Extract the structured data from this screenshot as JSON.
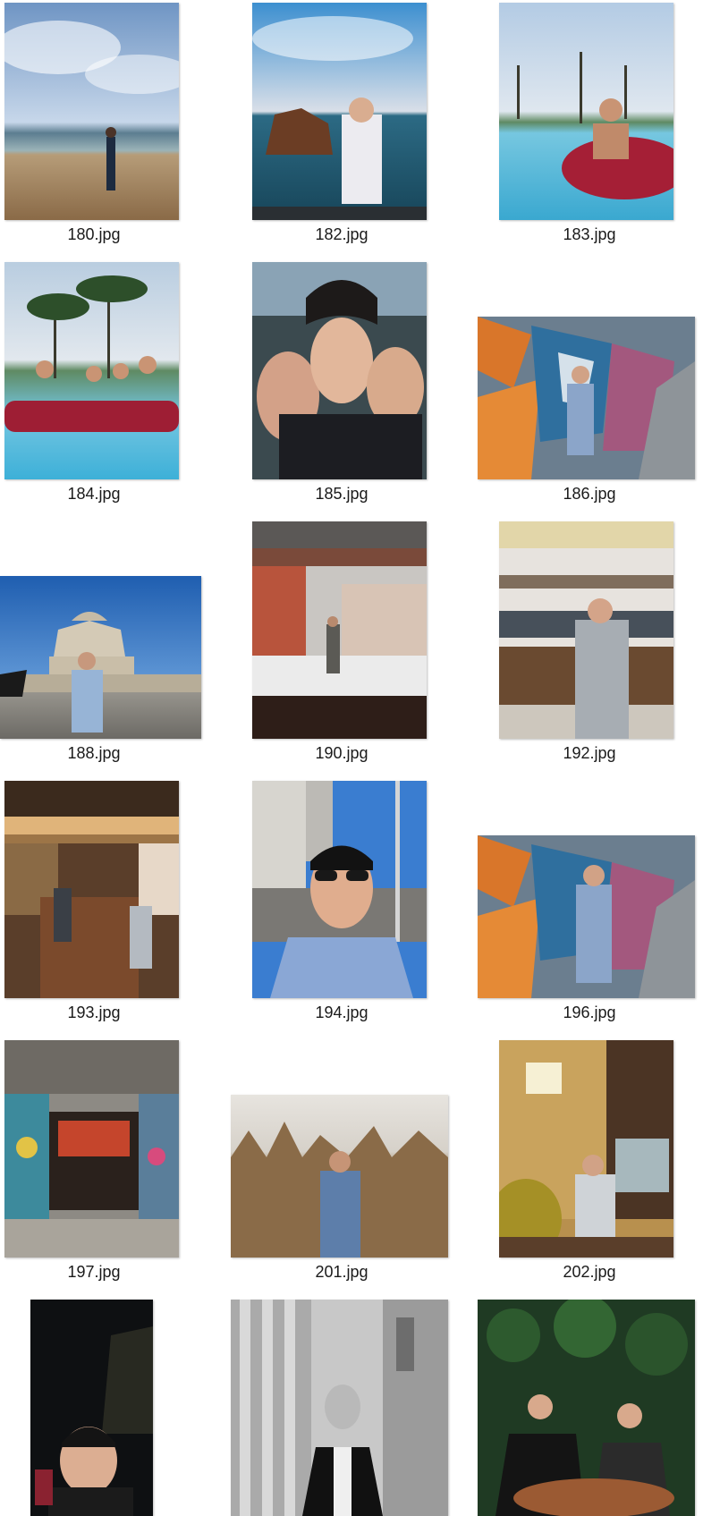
{
  "files": [
    {
      "name": "180.jpg"
    },
    {
      "name": "182.jpg"
    },
    {
      "name": "183.jpg"
    },
    {
      "name": "184.jpg"
    },
    {
      "name": "185.jpg"
    },
    {
      "name": "186.jpg"
    },
    {
      "name": "188.jpg"
    },
    {
      "name": "190.jpg"
    },
    {
      "name": "192.jpg"
    },
    {
      "name": "193.jpg"
    },
    {
      "name": "194.jpg"
    },
    {
      "name": "196.jpg"
    },
    {
      "name": "197.jpg"
    },
    {
      "name": "201.jpg"
    },
    {
      "name": "202.jpg"
    },
    {
      "name": "",
      "partial": true
    },
    {
      "name": "",
      "partial": true
    },
    {
      "name": "",
      "partial": true
    }
  ]
}
